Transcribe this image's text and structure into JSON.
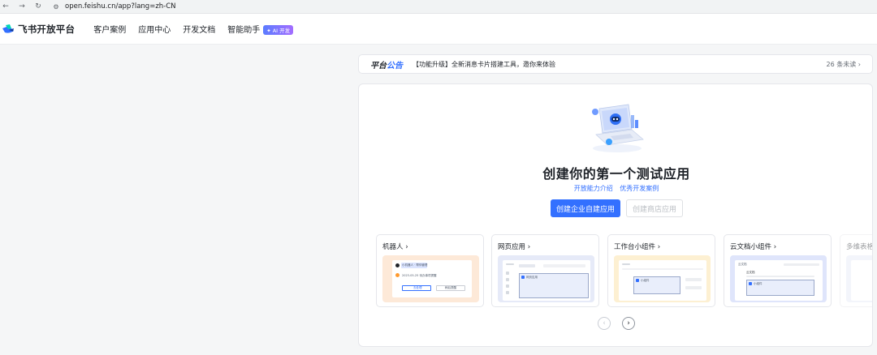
{
  "browser": {
    "back_icon": "arrow-left-icon",
    "forward_icon": "arrow-right-icon",
    "reload_icon": "reload-icon",
    "url": "open.feishu.cn/app?lang=zh-CN"
  },
  "header": {
    "logo_text": "飞书开放平台",
    "nav": [
      "客户案例",
      "应用中心",
      "开发文档",
      "智能助手"
    ],
    "ai_badge": "✦ AI 开发"
  },
  "announcement": {
    "title_part1": "平台",
    "title_part2": "公告",
    "text": "【功能升级】全新消息卡片搭建工具，邀你来体验",
    "more": "26 条未读 ›"
  },
  "hero": {
    "title": "创建你的第一个测试应用",
    "link_1": "开放能力介绍",
    "link_2": "优秀开发案例",
    "primary_button": "创建企业自建应用",
    "secondary_button": "创建商店应用"
  },
  "templates": [
    {
      "title": "机器人 ›",
      "mock_title": "小机器人 · 帮你管理",
      "mock_date": "2023-05-25 待办事项提醒",
      "mock_btn1": "去处理",
      "mock_btn2": "稍后提醒"
    },
    {
      "title": "网页应用 ›",
      "mock_tab": "网页应用"
    },
    {
      "title": "工作台小组件 ›",
      "mock_tab": "小组件"
    },
    {
      "title": "云文档小组件 ›",
      "mock_header": "云文档",
      "mock_sub": "云文档",
      "mock_tab": "小组件"
    },
    {
      "title": "多维表格…"
    }
  ],
  "pager": {
    "prev": "‹",
    "next": "›"
  },
  "colors": {
    "primary": "#3370ff",
    "bot_bg": "#fde9d8",
    "web_bg": "#e6eaf8",
    "widget_bg": "#fdf0d2",
    "doc_bg": "#dfe5fb"
  }
}
